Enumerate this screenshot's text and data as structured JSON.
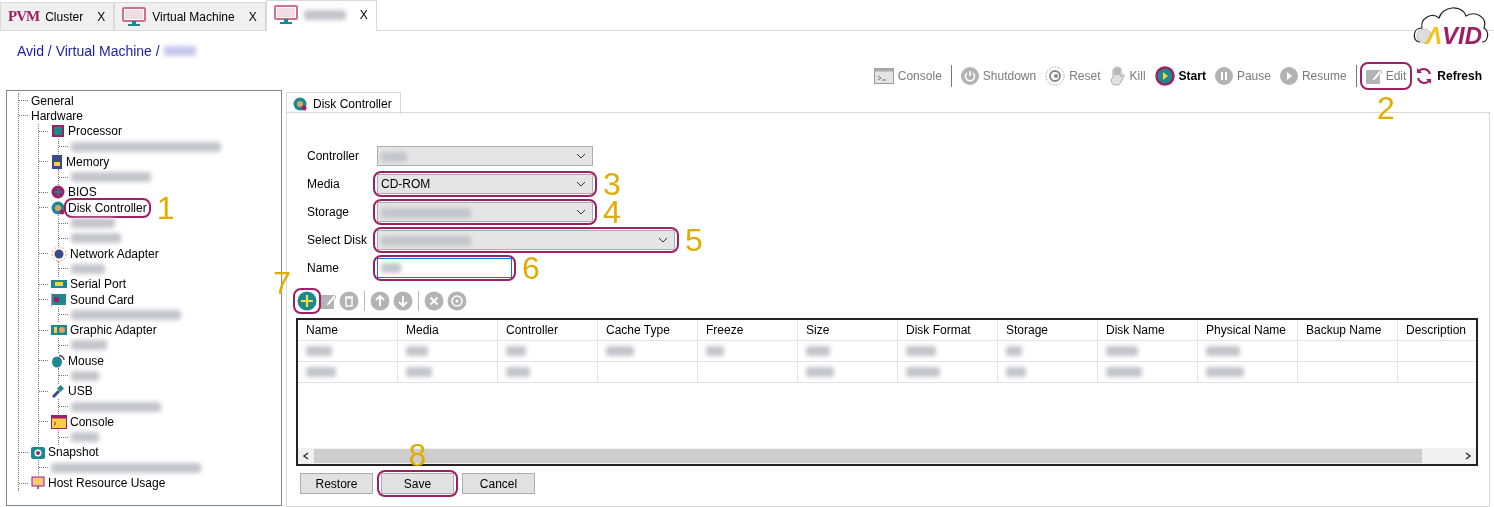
{
  "window_tabs": [
    {
      "kind": "pvm",
      "logo": "PVM",
      "label": "Cluster",
      "close": "X",
      "selected": false
    },
    {
      "kind": "monitor",
      "label": "Virtual Machine",
      "close": "X",
      "selected": false
    },
    {
      "kind": "monitor",
      "blurred": true,
      "close": "X",
      "selected": true
    }
  ],
  "breadcrumb": {
    "text": "Avid / Virtual Machine /",
    "blurred_tail": true
  },
  "logo": {
    "accent": "Λ",
    "text": "VID"
  },
  "toolbar": [
    {
      "kind": "console",
      "label": "Console",
      "disabled": true
    },
    {
      "kind": "separator"
    },
    {
      "kind": "power",
      "label": "Shutdown",
      "disabled": true
    },
    {
      "kind": "reset",
      "label": "Reset",
      "disabled": true
    },
    {
      "kind": "hand",
      "label": "Kill",
      "disabled": true
    },
    {
      "kind": "play",
      "label": "Start",
      "disabled": false
    },
    {
      "kind": "pause",
      "label": "Pause",
      "disabled": true
    },
    {
      "kind": "play",
      "label": "Resume",
      "disabled": true
    },
    {
      "kind": "separator"
    },
    {
      "kind": "edit",
      "label": "Edit",
      "disabled": true,
      "callout": "2"
    },
    {
      "kind": "refresh",
      "label": "Refresh",
      "disabled": false
    }
  ],
  "tree": [
    {
      "label": "General"
    },
    {
      "label": "Hardware",
      "children": [
        {
          "label": "Processor",
          "kind": "chip",
          "children": [
            {
              "kind": "blurred"
            }
          ]
        },
        {
          "label": "Memory",
          "kind": "memory",
          "children": [
            {
              "kind": "blurred"
            }
          ]
        },
        {
          "label": "BIOS",
          "kind": "bios"
        },
        {
          "label": "Disk Controller",
          "kind": "disc",
          "callout": "1",
          "children": [
            {
              "kind": "blurred"
            },
            {
              "kind": "blurred"
            }
          ]
        },
        {
          "label": "Network Adapter",
          "kind": "network",
          "children": [
            {
              "kind": "blurred"
            }
          ]
        },
        {
          "label": "Serial Port",
          "kind": "serial"
        },
        {
          "label": "Sound Card",
          "kind": "sound",
          "children": [
            {
              "kind": "blurred"
            }
          ]
        },
        {
          "label": "Graphic Adapter",
          "kind": "graphic",
          "children": [
            {
              "kind": "blurred"
            }
          ]
        },
        {
          "label": "Mouse",
          "kind": "mouse",
          "children": [
            {
              "kind": "blurred"
            }
          ]
        },
        {
          "label": "USB",
          "kind": "usb",
          "children": [
            {
              "kind": "blurred"
            }
          ]
        },
        {
          "label": "Console",
          "kind": "console",
          "children": [
            {
              "kind": "blurred"
            }
          ]
        }
      ]
    },
    {
      "label": "Snapshot",
      "kind": "camera",
      "children": [
        {
          "kind": "blurred"
        }
      ]
    },
    {
      "label": "Host Resource Usage",
      "kind": "monitor"
    }
  ],
  "detail_tab": {
    "label": "Disk Controller",
    "selected": true
  },
  "fields": [
    {
      "label": "Controller",
      "kind": "select",
      "blurred": true
    },
    {
      "label": "Media",
      "kind": "select",
      "value": "CD-ROM",
      "callout": "3"
    },
    {
      "label": "Storage",
      "kind": "select",
      "blurred": true,
      "callout": "4"
    },
    {
      "label": "Select Disk",
      "kind": "select",
      "blurred": true,
      "callout": "5"
    },
    {
      "label": "Name",
      "kind": "input",
      "blurred": true,
      "focused": true,
      "callout": "6"
    }
  ],
  "grid_toolbar": [
    {
      "kind": "add",
      "disabled": false,
      "callout": "7"
    },
    {
      "kind": "edit",
      "disabled": true
    },
    {
      "kind": "delete",
      "disabled": true
    },
    {
      "kind": "separator"
    },
    {
      "kind": "up",
      "disabled": true
    },
    {
      "kind": "down",
      "disabled": true
    },
    {
      "kind": "separator"
    },
    {
      "kind": "remove",
      "disabled": true
    },
    {
      "kind": "disc",
      "disabled": true
    }
  ],
  "table": {
    "columns": [
      "Name",
      "Media",
      "Controller",
      "Cache Type",
      "Freeze",
      "Size",
      "Disk Format",
      "Storage",
      "Disk Name",
      "Physical Name",
      "Backup Name",
      "Description"
    ],
    "rows": [
      {
        "cells": [
          {
            "blurred": true
          },
          {
            "blurred": true
          },
          {
            "blurred": true
          },
          {
            "blurred": true
          },
          {
            "blurred": true
          },
          {
            "blurred": true
          },
          {
            "blurred": true
          },
          {
            "blurred": true
          },
          {
            "blurred": true
          },
          {
            "blurred": true
          },
          {
            "blurred": false
          },
          {
            "blurred": false
          }
        ]
      },
      {
        "cells": [
          {
            "blurred": true
          },
          {
            "blurred": true
          },
          {
            "blurred": true
          },
          {
            "blurred": false
          },
          {
            "blurred": false
          },
          {
            "blurred": true
          },
          {
            "blurred": true
          },
          {
            "blurred": true
          },
          {
            "blurred": true
          },
          {
            "blurred": true
          },
          {
            "blurred": false
          },
          {
            "blurred": false
          }
        ]
      }
    ]
  },
  "buttons": [
    {
      "label": "Restore"
    },
    {
      "label": "Save",
      "callout": "8"
    },
    {
      "label": "Cancel"
    }
  ]
}
